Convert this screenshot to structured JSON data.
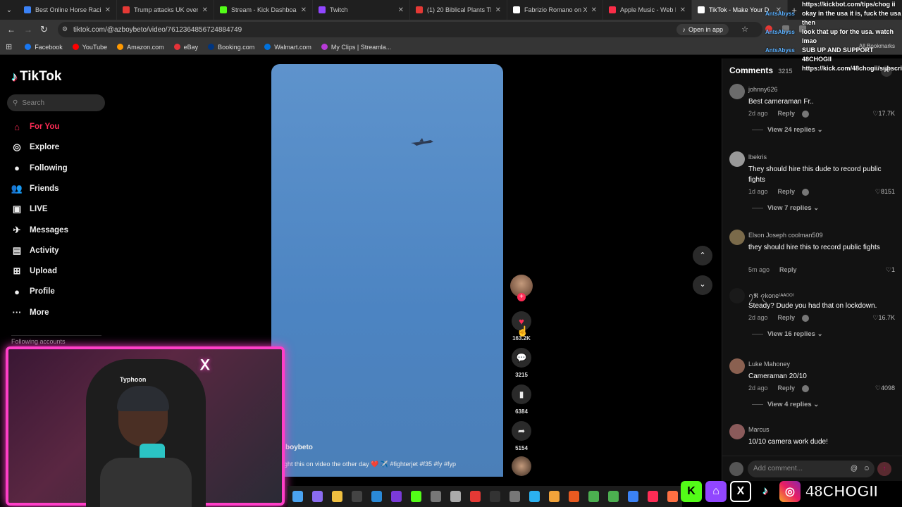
{
  "browser": {
    "tabs": [
      {
        "title": "Best Online Horse Racing",
        "color": "#3b82f6"
      },
      {
        "title": "Trump attacks UK over Ira",
        "color": "#e53935"
      },
      {
        "title": "Stream - Kick Dashboard",
        "color": "#53fc18"
      },
      {
        "title": "Twitch",
        "color": "#9146ff"
      },
      {
        "title": "(1) 20 Biblical Plants That",
        "color": "#e53935"
      },
      {
        "title": "Fabrizio Romano on X: \"",
        "color": "#ffffff"
      },
      {
        "title": "Apple Music - Web Player",
        "color": "#fa2d48"
      },
      {
        "title": "TikTok - Make Your D",
        "color": "#ffffff"
      }
    ],
    "url": "tiktok.com/@azboybeto/video/7612364856724884749",
    "open_in_app": "Open in app",
    "bookmarks": [
      {
        "label": "Facebook",
        "color": "#1877f2"
      },
      {
        "label": "YouTube",
        "color": "#ff0000"
      },
      {
        "label": "Amazon.com",
        "color": "#ff9900"
      },
      {
        "label": "eBay",
        "color": "#e53238"
      },
      {
        "label": "Booking.com",
        "color": "#003580"
      },
      {
        "label": "Walmart.com",
        "color": "#0071dc"
      },
      {
        "label": "My Clips | Streamla...",
        "color": "#b83bd7"
      }
    ],
    "all_bookmarks": "All Bookmarks"
  },
  "sidebar": {
    "logo": "TikTok",
    "search_placeholder": "Search",
    "items": [
      {
        "label": "For You",
        "icon": "home-icon",
        "glyph": "⌂",
        "active": true
      },
      {
        "label": "Explore",
        "icon": "compass-icon",
        "glyph": "◎",
        "active": false
      },
      {
        "label": "Following",
        "icon": "following-icon",
        "glyph": "●",
        "active": false
      },
      {
        "label": "Friends",
        "icon": "friends-icon",
        "glyph": "👥",
        "active": false
      },
      {
        "label": "LIVE",
        "icon": "live-icon",
        "glyph": "▣",
        "active": false
      },
      {
        "label": "Messages",
        "icon": "messages-icon",
        "glyph": "✈",
        "active": false
      },
      {
        "label": "Activity",
        "icon": "activity-icon",
        "glyph": "▤",
        "active": false
      },
      {
        "label": "Upload",
        "icon": "upload-icon",
        "glyph": "⊞",
        "active": false
      },
      {
        "label": "Profile",
        "icon": "profile-icon",
        "glyph": "●",
        "active": false
      },
      {
        "label": "More",
        "icon": "more-icon",
        "glyph": "···",
        "active": false
      }
    ],
    "following_accounts": "Following accounts"
  },
  "video": {
    "author": "@azboybeto",
    "author_visible": "boybeto",
    "caption": "ght this on video the other day ❤️ ✈️ #fighterjet #f35 #fy #fyp"
  },
  "actions": {
    "likes": "163.2K",
    "comments": "3215",
    "saves": "6384",
    "shares": "5154"
  },
  "comments_panel": {
    "title": "Comments",
    "count": "3215",
    "reply_label": "Reply",
    "add_placeholder": "Add comment...",
    "items": [
      {
        "user": "johnny626",
        "text": "Best cameraman Fr..",
        "time": "2d ago",
        "likes": "17.7K",
        "replies": "View 24 replies",
        "avatar": "#6b6b6b"
      },
      {
        "user": "lbekris",
        "text": "They should hire this dude to record public fights",
        "time": "1d ago",
        "likes": "8151",
        "replies": "View 7 replies",
        "avatar": "#999999"
      },
      {
        "user": "Elson Joseph coolman509",
        "text": "they should hire this to record public fights",
        "time": "5m ago",
        "likes": "1",
        "replies": "",
        "avatar": "#7a6a4a"
      },
      {
        "user": "ꪆ𝕽 ꪖkone⁽ᴬᴬᴼᴼ⁾",
        "text": "Steady? Dude you had that on lockdown.",
        "time": "2d ago",
        "likes": "16.7K",
        "replies": "View 16 replies",
        "avatar": "#1a1a1a"
      },
      {
        "user": "Luke Mahoney",
        "text": "Cameraman 20/10",
        "time": "2d ago",
        "likes": "4098",
        "replies": "View 4 replies",
        "avatar": "#8a6050"
      },
      {
        "user": "Marcus",
        "text": "10/10 camera work dude!",
        "time": "",
        "likes": "",
        "replies": "",
        "avatar": "#8a5a5a"
      }
    ]
  },
  "chat_overlay": [
    {
      "user": "",
      "text": "https://kickbot.com/tips/chog ii"
    },
    {
      "user": "AntsAbyss",
      "text": "okay in the usa it is, fuck the usa then"
    },
    {
      "user": "AntsAbyss",
      "text": "look that up for the usa. watch"
    },
    {
      "user": "",
      "text": "lmao"
    },
    {
      "user": "AntsAbyss",
      "text": ""
    },
    {
      "user": "",
      "text": "SUB UP AND SUPPORT 48CHOGII"
    },
    {
      "user": "",
      "text": "https://kick.com/48chogii/subscribe"
    }
  ],
  "webcam": {
    "chair_brand": "Typhoon",
    "label": "streamer-webcam"
  },
  "branding": {
    "handle": "48CHOGII"
  }
}
